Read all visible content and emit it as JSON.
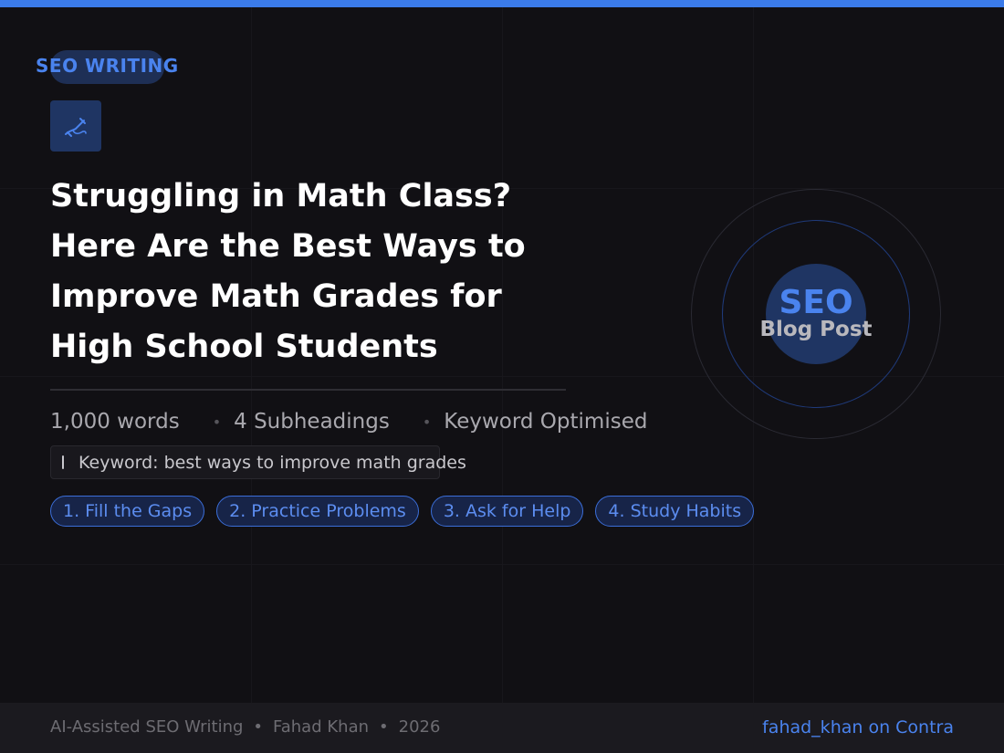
{
  "colors": {
    "accent": "#3b7bea",
    "background": "#111014",
    "chip_border": "#3b6ed8"
  },
  "tag": {
    "label": "SEO WRITING"
  },
  "icon": {
    "name": "writing-hand-icon"
  },
  "title": {
    "lines": [
      "Struggling in Math Class?",
      "Here Are the Best Ways to",
      "Improve Math Grades for",
      "High School Students"
    ]
  },
  "meta": {
    "words": "1,000 words",
    "subheadings": "4 Subheadings",
    "optimised": "Keyword Optimised",
    "separator": "•"
  },
  "keyword": {
    "icon": "document-icon",
    "text": "Keyword: best ways to improve math grades"
  },
  "chips": [
    {
      "label": "1. Fill the Gaps"
    },
    {
      "label": "2. Practice Problems"
    },
    {
      "label": "3. Ask for Help"
    },
    {
      "label": "4. Study Habits"
    }
  ],
  "badge": {
    "title": "SEO",
    "subtitle": "Blog Post"
  },
  "footer": {
    "left": [
      "AI-Assisted SEO Writing",
      "Fahad Khan",
      "2026"
    ],
    "separator": "•",
    "right": "fahad_khan on Contra"
  }
}
